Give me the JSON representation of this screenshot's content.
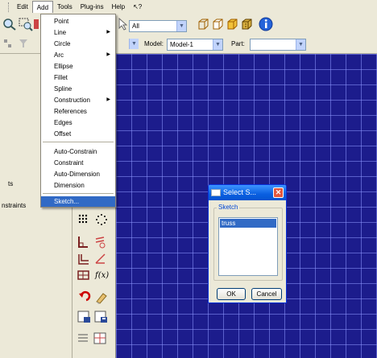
{
  "menubar": {
    "items": [
      {
        "label": "Edit"
      },
      {
        "label": "Add"
      },
      {
        "label": "Tools"
      },
      {
        "label": "Plug-ins"
      },
      {
        "label": "Help"
      },
      {
        "label": "↖?"
      }
    ]
  },
  "toolbar": {
    "filter_select": "All",
    "model_label": "Model:",
    "model_value": "Model-1",
    "part_label": "Part:",
    "part_value": ""
  },
  "left_panel": {
    "text1": "ts",
    "text2": "nstraints"
  },
  "add_menu": {
    "items": [
      {
        "label": "Point",
        "submenu": false
      },
      {
        "label": "Line",
        "submenu": true
      },
      {
        "label": "Circle",
        "submenu": false
      },
      {
        "label": "Arc",
        "submenu": true
      },
      {
        "label": "Ellipse",
        "submenu": false
      },
      {
        "label": "Fillet",
        "submenu": false
      },
      {
        "label": "Spline",
        "submenu": false
      },
      {
        "label": "Construction",
        "submenu": true
      },
      {
        "label": "References",
        "submenu": false
      },
      {
        "label": "Edges",
        "submenu": false
      },
      {
        "label": "Offset",
        "submenu": false
      },
      {
        "label": "Auto-Constrain",
        "submenu": false
      },
      {
        "label": "Constraint",
        "submenu": false
      },
      {
        "label": "Auto-Dimension",
        "submenu": false
      },
      {
        "label": "Dimension",
        "submenu": false
      },
      {
        "label": "Sketch...",
        "submenu": false,
        "highlighted": true
      }
    ]
  },
  "toolbox": {
    "fx_label": "f(x)"
  },
  "dialog": {
    "title": "Select S...",
    "group_label": "Sketch",
    "list_items": [
      "truss"
    ],
    "ok_label": "OK",
    "cancel_label": "Cancel"
  },
  "colors": {
    "viewport_bg": "#1c1c8c",
    "highlight": "#316ac5",
    "titlebar": "#0a5fe0"
  }
}
